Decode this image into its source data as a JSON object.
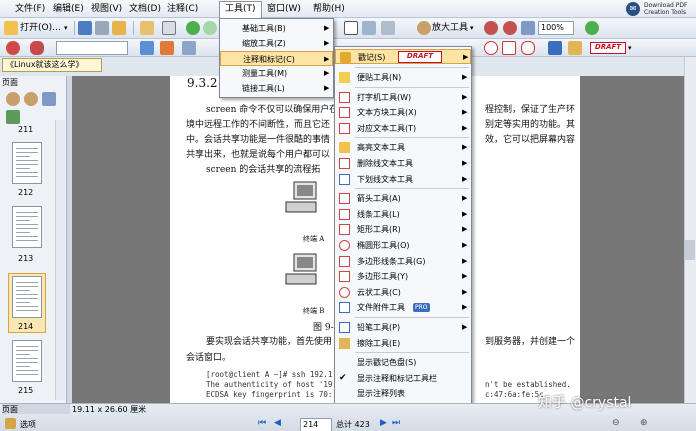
{
  "menubar": {
    "items": [
      "文件(F)",
      "编辑(E)",
      "视图(V)",
      "文档(D)",
      "注释(C)",
      "工具(T)",
      "窗口(W)",
      "帮助(H)"
    ],
    "logo_line1": "Download PDF",
    "logo_line2": "Creation Tools"
  },
  "toolbar1": {
    "open_label": "打开(O)...",
    "zoom_tool_label": "放大工具",
    "zoom_value": "100%"
  },
  "toolbar2": {
    "draft_stamp": "DRAFT"
  },
  "doc_tab": {
    "title": "《Linux就该这么学》"
  },
  "left_panel": {
    "title": "页面",
    "thumbs": [
      "211",
      "212",
      "213",
      "214",
      "215"
    ],
    "bottom_label": "页面"
  },
  "document": {
    "section": "9.3.2",
    "lines": [
      "screen 命令不仅可以确保用户在",
      "境中远程工作的不间断性，而且它还",
      "中。会话共享功能是一件很酷的事情",
      "共享出来，也就是说每个用户都可以",
      "screen 的会话共享的流程拓"
    ],
    "right_lines": [
      "程控制，保证了生产环",
      "别定等实用的功能。其",
      "效，它可以把屏幕内容"
    ],
    "term_a": "终端 A",
    "term_b": "终端 B",
    "fig": "图 9-1",
    "bottom_line1": "要实现会话共享功能，首先使用",
    "bottom_line1_right": "到服务器，并创建一个",
    "bottom_line2": "会话窗口。",
    "code1": "[root@client A ~]# ssh 192.1",
    "code2": "The authenticity of host '19",
    "code2_right": "n't be established.",
    "code3": "ECDSA key fingerprint is 70:",
    "code3_right": "c:47:6a:fe:5c."
  },
  "tools_menu": {
    "items": [
      {
        "label": "基础工具(B)",
        "arrow": true
      },
      {
        "label": "缩放工具(Z)",
        "arrow": true
      },
      {
        "label": "注释和标记(C)",
        "arrow": true,
        "highlight": true
      },
      {
        "label": "测量工具(M)",
        "arrow": true
      },
      {
        "label": "链接工具(L)",
        "arrow": true
      }
    ]
  },
  "annot_submenu": {
    "stamp_label": "戳记(S)",
    "stamp_text": "DRAFT",
    "groups": [
      [
        {
          "label": "便贴工具(N)",
          "icon": "note-icon",
          "arrow": true
        }
      ],
      [
        {
          "label": "打字机工具(W)",
          "icon": "typewriter-icon",
          "arrow": true
        },
        {
          "label": "文本方块工具(X)",
          "icon": "textbox-icon",
          "arrow": true
        },
        {
          "label": "对应文本工具(T)",
          "icon": "callout-icon",
          "arrow": true
        }
      ],
      [
        {
          "label": "高亮文本工具",
          "icon": "highlight-icon",
          "arrow": true
        },
        {
          "label": "删除线文本工具",
          "icon": "strikeout-icon",
          "arrow": true
        },
        {
          "label": "下划线文本工具",
          "icon": "underline-icon",
          "arrow": true
        }
      ],
      [
        {
          "label": "箭头工具(A)",
          "icon": "arrow-icon",
          "arrow": true
        },
        {
          "label": "线条工具(L)",
          "icon": "line-icon",
          "arrow": true
        },
        {
          "label": "矩形工具(R)",
          "icon": "rectangle-icon",
          "arrow": true
        },
        {
          "label": "椭圆形工具(O)",
          "icon": "ellipse-icon",
          "arrow": true
        },
        {
          "label": "多边形线条工具(G)",
          "icon": "polyline-icon",
          "arrow": true
        },
        {
          "label": "多边形工具(Y)",
          "icon": "polygon-icon",
          "arrow": true
        },
        {
          "label": "云状工具(C)",
          "icon": "cloud-icon",
          "arrow": true
        },
        {
          "label": "文件附件工具",
          "icon": "attachment-icon",
          "arrow": true,
          "badge": "PRO"
        }
      ],
      [
        {
          "label": "铅笔工具(P)",
          "icon": "pencil-icon",
          "arrow": true
        },
        {
          "label": "擦除工具(E)",
          "icon": "eraser-icon",
          "arrow": false
        }
      ],
      [
        {
          "label": "显示戳记色盘(S)",
          "icon": "",
          "arrow": false
        },
        {
          "label": "显示注释和标记工具栏",
          "icon": "check-icon",
          "arrow": false
        },
        {
          "label": "显示注释列表",
          "icon": "",
          "arrow": false
        }
      ]
    ]
  },
  "statusbar": {
    "options_label": "选项",
    "page_size": "19.11 x 26.60 厘米",
    "page_number": "214",
    "page_total": "总计 423"
  },
  "watermark": "知乎 @crystal",
  "colors": {
    "accent_highlight": "#fde4a5",
    "draft_red": "#c8102e"
  }
}
